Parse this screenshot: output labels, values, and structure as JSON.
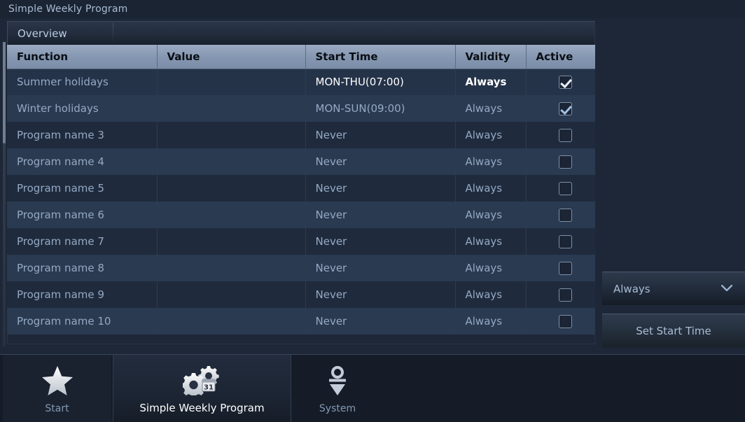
{
  "window": {
    "title": "Simple Weekly Program"
  },
  "panel": {
    "tab_label": "Overview"
  },
  "table": {
    "columns": [
      "Function",
      "Value",
      "Start Time",
      "Validity",
      "Active"
    ],
    "rows": [
      {
        "function": "Summer holidays",
        "value": "",
        "start_time": "MON-THU(07:00)",
        "validity": "Always",
        "active": true
      },
      {
        "function": "Winter holidays",
        "value": "",
        "start_time": "MON-SUN(09:00)",
        "validity": "Always",
        "active": true
      },
      {
        "function": "Program name 3",
        "value": "",
        "start_time": "Never",
        "validity": "Always",
        "active": false
      },
      {
        "function": "Program name 4",
        "value": "",
        "start_time": "Never",
        "validity": "Always",
        "active": false
      },
      {
        "function": "Program name 5",
        "value": "",
        "start_time": "Never",
        "validity": "Always",
        "active": false
      },
      {
        "function": "Program name 6",
        "value": "",
        "start_time": "Never",
        "validity": "Always",
        "active": false
      },
      {
        "function": "Program name 7",
        "value": "",
        "start_time": "Never",
        "validity": "Always",
        "active": false
      },
      {
        "function": "Program name 8",
        "value": "",
        "start_time": "Never",
        "validity": "Always",
        "active": false
      },
      {
        "function": "Program name 9",
        "value": "",
        "start_time": "Never",
        "validity": "Always",
        "active": false
      },
      {
        "function": "Program name 10",
        "value": "",
        "start_time": "Never",
        "validity": "Always",
        "active": false
      }
    ]
  },
  "controls": {
    "validity_select": {
      "value": "Always",
      "icon": "chevron-down-icon"
    },
    "set_start_time_button": {
      "label": "Set Start Time"
    }
  },
  "taskbar": {
    "items": [
      {
        "label": "Start",
        "icon": "star-icon",
        "active": false
      },
      {
        "label": "Simple Weekly Program",
        "icon": "gears-calendar-icon",
        "active": true
      },
      {
        "label": "System",
        "icon": "system-icon",
        "active": false
      }
    ]
  },
  "colors": {
    "background": "#1d2737",
    "header_row": "#8496b0",
    "row_odd": "#1f2b3d",
    "row_even": "#2a3a50",
    "text_primary": "#94a9c4",
    "text_bright": "#ffffff"
  }
}
